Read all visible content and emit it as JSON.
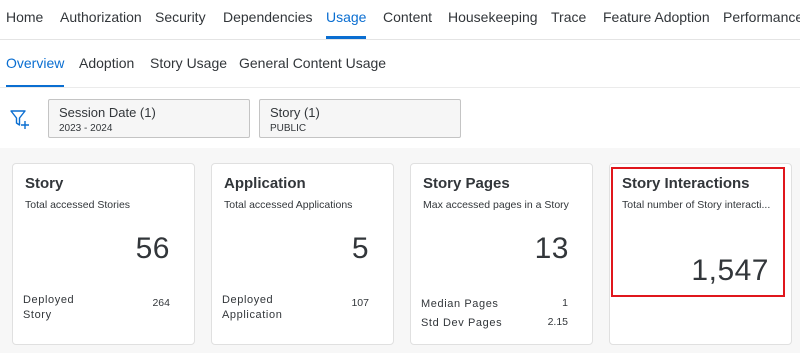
{
  "top_nav": {
    "tabs": [
      {
        "label": "Home"
      },
      {
        "label": "Authorization"
      },
      {
        "label": "Security"
      },
      {
        "label": "Dependencies"
      },
      {
        "label": "Usage",
        "active": true
      },
      {
        "label": "Content"
      },
      {
        "label": "Housekeeping"
      },
      {
        "label": "Trace"
      },
      {
        "label": "Feature Adoption"
      },
      {
        "label": "Performance"
      }
    ]
  },
  "sub_nav": {
    "tabs": [
      {
        "label": "Overview",
        "active": true
      },
      {
        "label": "Adoption"
      },
      {
        "label": "Story Usage"
      },
      {
        "label": "General Content Usage"
      }
    ]
  },
  "filters": [
    {
      "title": "Session Date (1)",
      "value": "2023 - 2024"
    },
    {
      "title": "Story (1)",
      "value": "PUBLIC"
    }
  ],
  "cards": [
    {
      "title": "Story",
      "subtitle": "Total accessed Stories",
      "value": "56",
      "footer": [
        {
          "label": "Deployed Story",
          "value": "264"
        }
      ]
    },
    {
      "title": "Application",
      "subtitle": "Total accessed Applications",
      "value": "5",
      "footer": [
        {
          "label": "Deployed Application",
          "value": "107"
        }
      ]
    },
    {
      "title": "Story Pages",
      "subtitle": "Max accessed pages in a Story",
      "value": "13",
      "footer": [
        {
          "label": "Median Pages",
          "value": "1"
        },
        {
          "label": "Std Dev Pages",
          "value": "2.15"
        }
      ]
    },
    {
      "title": "Story Interactions",
      "subtitle": "Total number of Story interacti...",
      "value": "1,547",
      "highlighted": true
    }
  ],
  "colors": {
    "accent": "#0a6ed1",
    "highlight": "#e0161c",
    "text": "#32363a"
  },
  "icons": {
    "filter": "filter-add-icon"
  }
}
